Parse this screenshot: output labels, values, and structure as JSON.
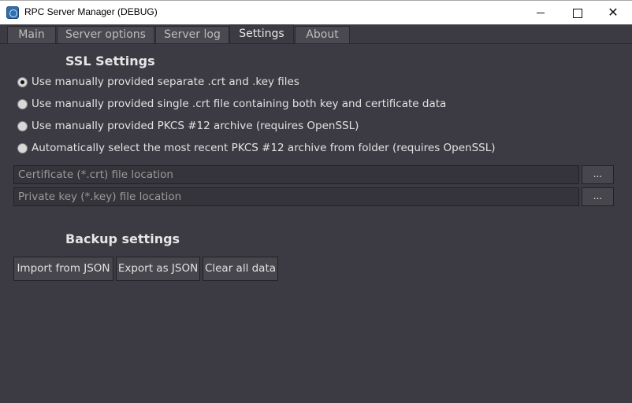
{
  "window": {
    "title": "RPC Server Manager (DEBUG)",
    "close_symbol": "✕"
  },
  "tabs": [
    {
      "label": "Main"
    },
    {
      "label": "Server options"
    },
    {
      "label": "Server log"
    },
    {
      "label": "Settings",
      "active": true
    },
    {
      "label": "About"
    }
  ],
  "ssl": {
    "title": "SSL Settings",
    "options": [
      {
        "label": "Use manually provided separate .crt and .key files",
        "checked": true
      },
      {
        "label": "Use manually provided single .crt file containing both key and certificate data",
        "checked": false
      },
      {
        "label": "Use manually provided PKCS #12 archive (requires OpenSSL)",
        "checked": false
      },
      {
        "label": "Automatically select the most recent PKCS #12 archive from folder (requires OpenSSL)",
        "checked": false
      }
    ],
    "certificate": {
      "value": "",
      "placeholder": "Certificate (*.crt) file location",
      "browse_label": "..."
    },
    "private_key": {
      "value": "",
      "placeholder": "Private key (*.key) file location",
      "browse_label": "..."
    }
  },
  "backup": {
    "title": "Backup settings",
    "import_label": "Import from JSON",
    "export_label": "Export as JSON",
    "clear_label": "Clear all data"
  },
  "colors": {
    "background": "#3c3b43",
    "control": "#47464d",
    "text": "#e2e2e2"
  }
}
